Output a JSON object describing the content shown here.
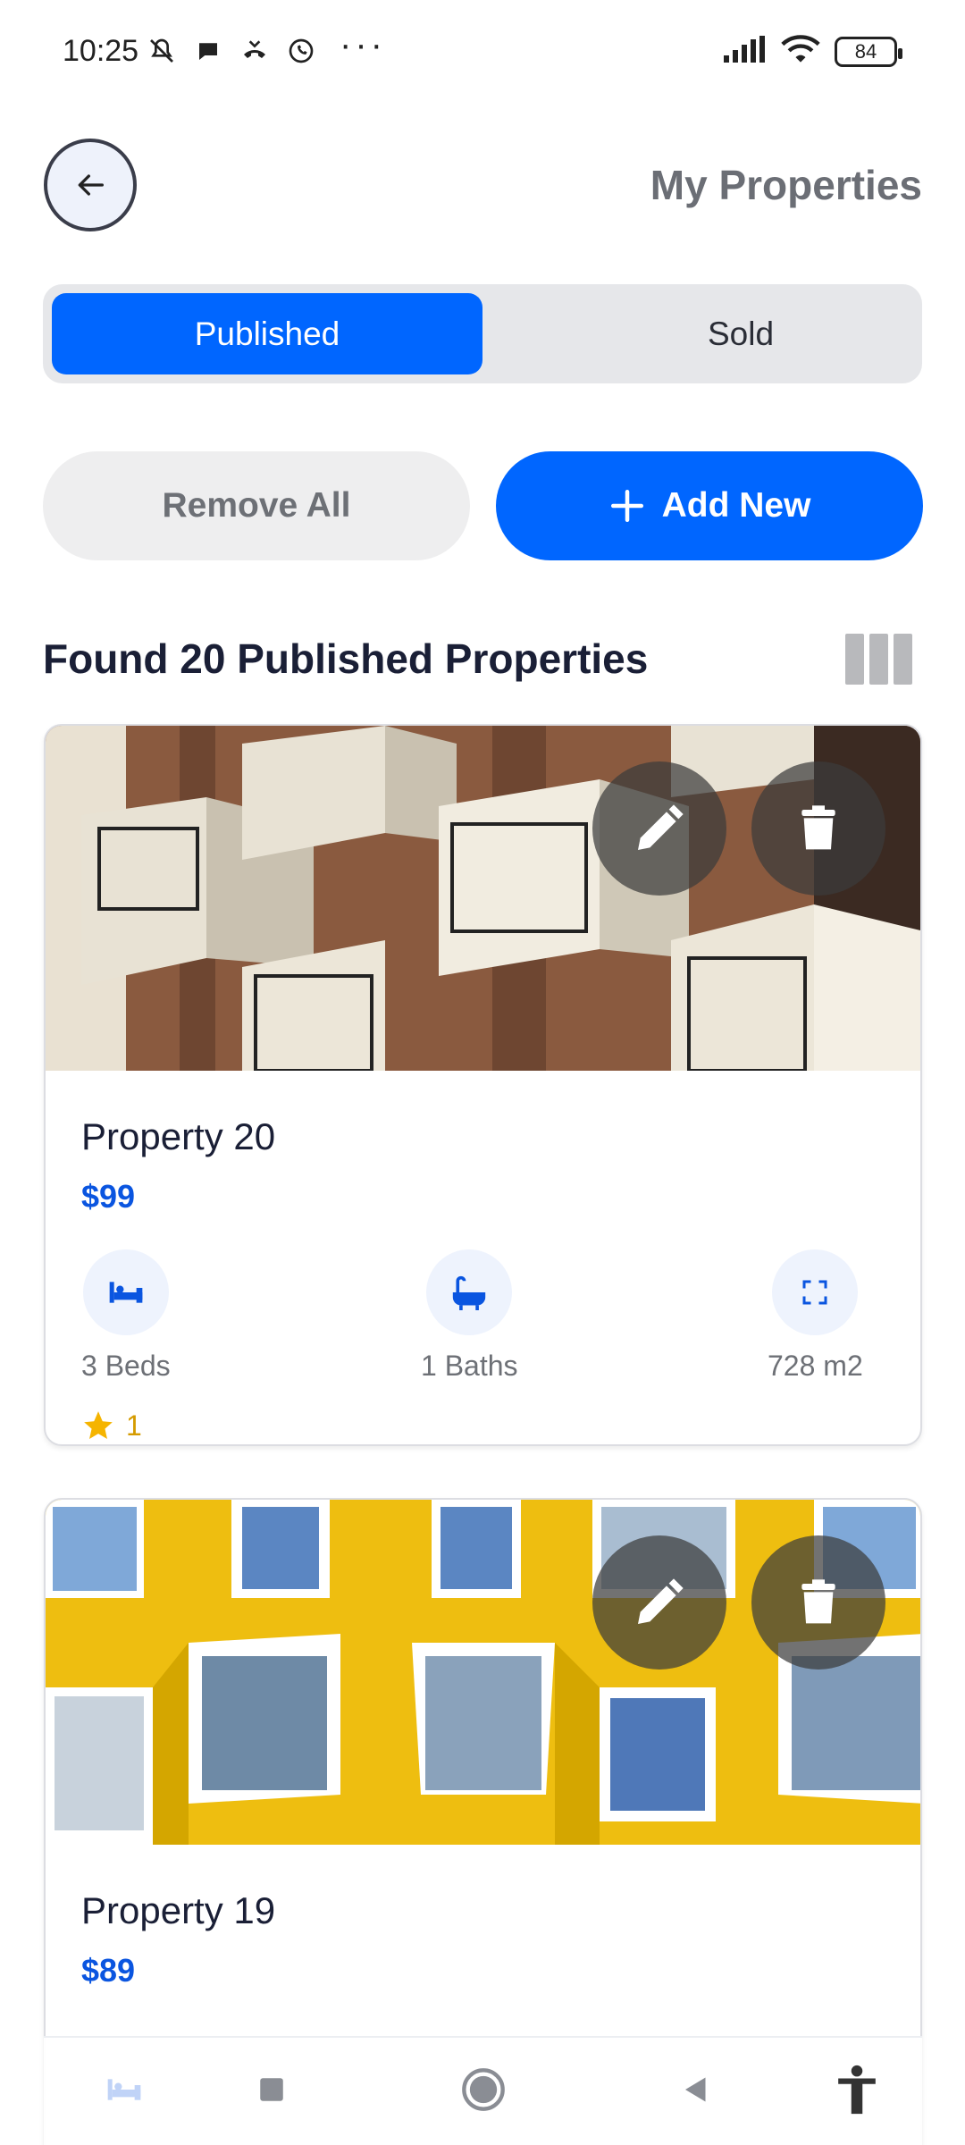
{
  "status_bar": {
    "time": "10:25",
    "dots": "···",
    "battery": "84",
    "icons": [
      "mute-icon",
      "chat-icon",
      "missed-call-icon",
      "whatsapp-icon",
      "signal-icon",
      "wifi-icon"
    ]
  },
  "header": {
    "title": "My Properties",
    "back_icon": "arrow-left-icon"
  },
  "tabs": [
    {
      "label": "Published",
      "active": true
    },
    {
      "label": "Sold",
      "active": false
    }
  ],
  "actions": {
    "remove_all": "Remove All",
    "add_new": "Add New"
  },
  "list": {
    "title": "Found 20 Published Properties",
    "view_toggle_icon": "grid-view-icon"
  },
  "properties": [
    {
      "name": "Property 20",
      "price": "$99",
      "beds": "3 Beds",
      "baths": "1 Baths",
      "area": "728 m2",
      "rating": "1",
      "image_theme": "brown-balconies"
    },
    {
      "name": "Property 19",
      "price": "$89",
      "image_theme": "yellow-windows"
    }
  ],
  "colors": {
    "accent": "#0066ff",
    "price": "#0a55e0",
    "star": "#f5b400"
  }
}
